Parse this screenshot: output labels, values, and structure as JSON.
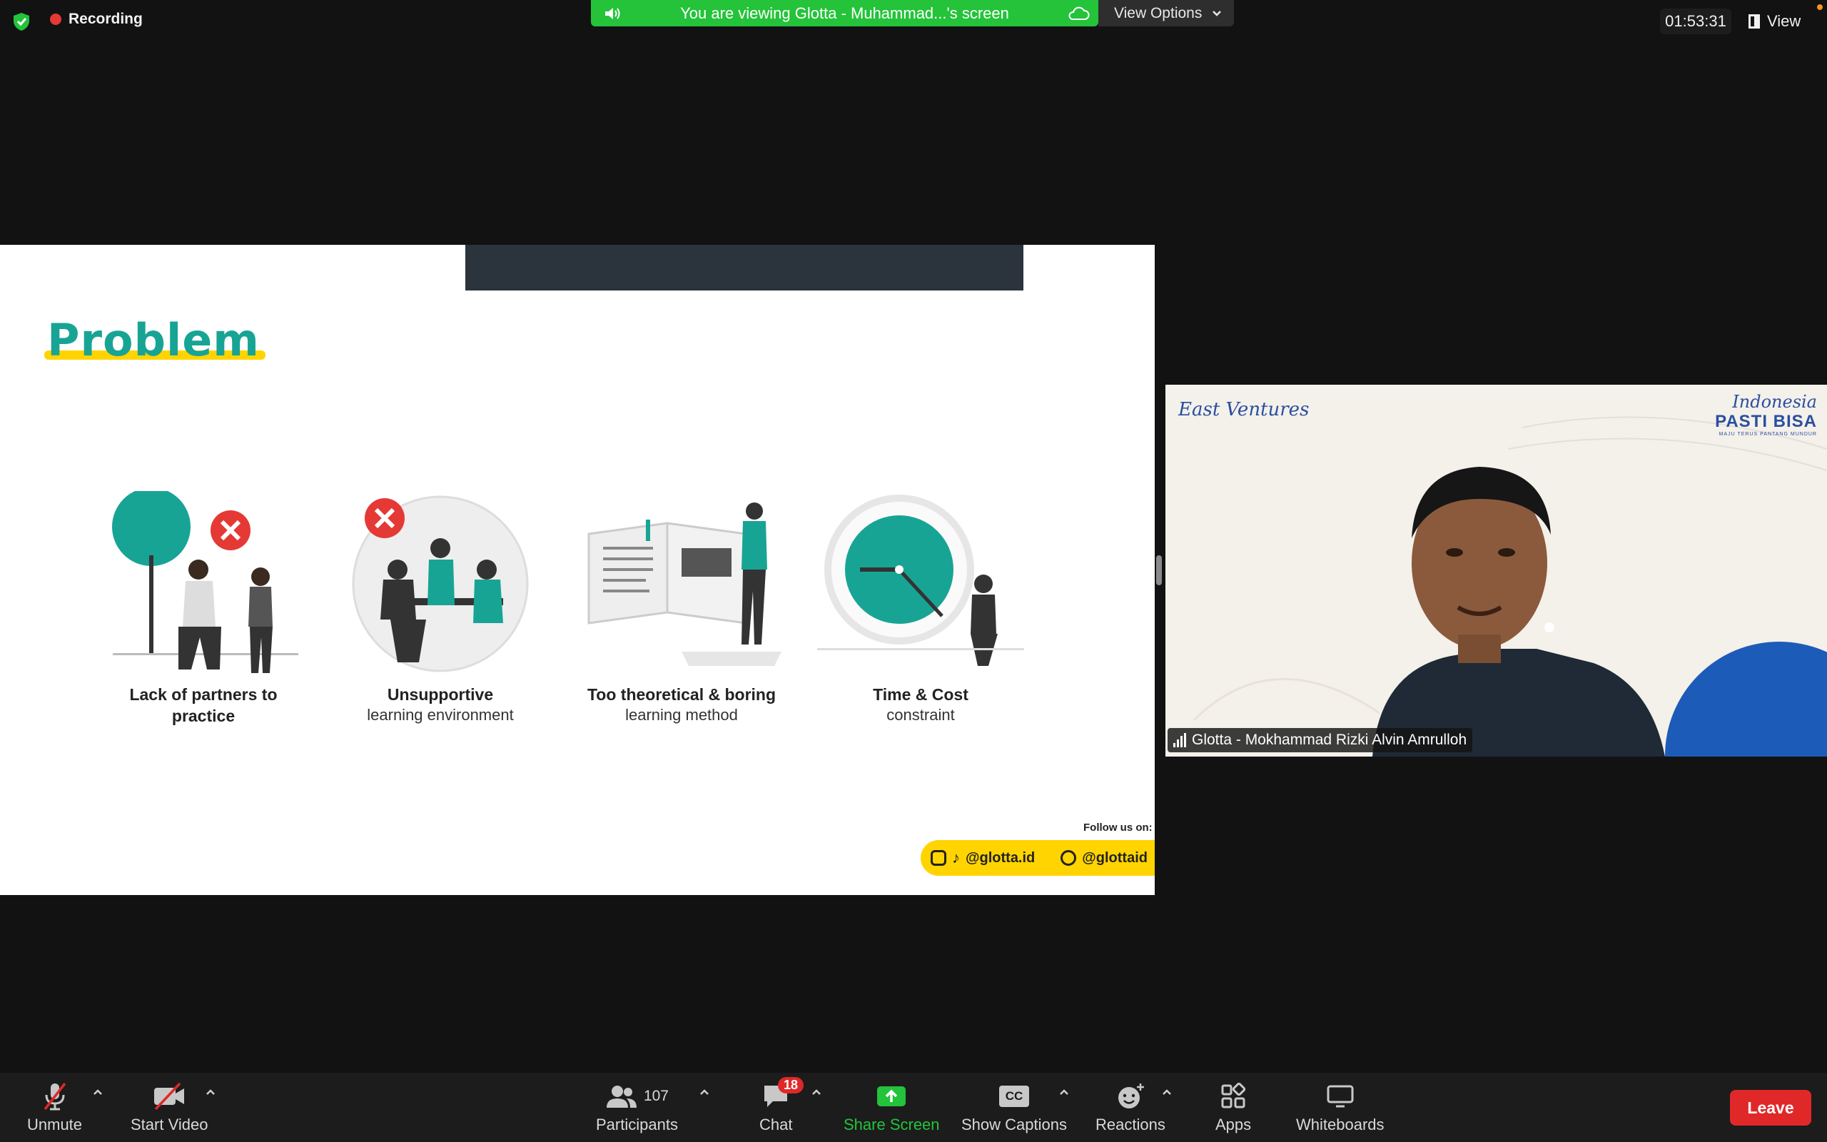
{
  "top_bar": {
    "recording_label": "Recording",
    "viewing_text": "You are viewing Glotta - Muhammad...'s screen",
    "view_options_label": "View Options",
    "meeting_timer": "01:53:31",
    "view_label": "View"
  },
  "slide": {
    "title": "Problem",
    "items": [
      {
        "label": "Lack of partners to practice",
        "sub": ""
      },
      {
        "label": "Unsupportive",
        "sub": "learning environment"
      },
      {
        "label": "Too theoretical & boring",
        "sub": "learning method"
      },
      {
        "label": "Time & Cost",
        "sub": "constraint"
      }
    ],
    "follow_label": "Follow us on:",
    "handle_primary": "@glotta.id",
    "handle_secondary": "@glottaid"
  },
  "speaker": {
    "name": "Glotta - Mokhammad Rizki Alvin Amrulloh",
    "logo_left": "East Ventures",
    "logo_right_script": "Indonesia",
    "logo_right_bold": "PASTI BISA",
    "logo_right_small": "MAJU TERUS PANTANG MUNDUR"
  },
  "toolbar": {
    "unmute_label": "Unmute",
    "start_video_label": "Start Video",
    "participants_count": "107",
    "participants_label": "Participants",
    "chat_label": "Chat",
    "chat_badge": "18",
    "share_label": "Share Screen",
    "captions_label": "Show Captions",
    "captions_icon_text": "CC",
    "reactions_label": "Reactions",
    "apps_label": "Apps",
    "whiteboards_label": "Whiteboards",
    "leave_label": "Leave"
  },
  "colors": {
    "accent_green": "#24c33a",
    "teal": "#18a495",
    "leave_red": "#e02828",
    "yellow": "#ffd400"
  }
}
